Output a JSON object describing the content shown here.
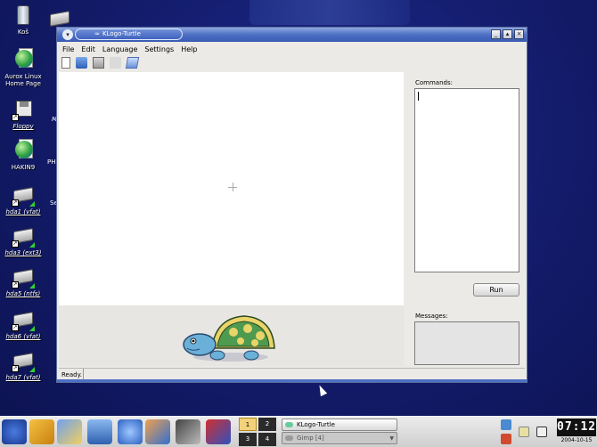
{
  "desktop": {
    "icons": [
      {
        "label": "Koš"
      },
      {
        "label": "Aurox Linux Home Page"
      },
      {
        "label": "Floppy"
      },
      {
        "label": "HAKIN9"
      },
      {
        "label": "hda1 (vfat)"
      },
      {
        "label": "hda3 (ext3)"
      },
      {
        "label": "hda5 (ntfs)"
      },
      {
        "label": "hda6 (vfat)"
      },
      {
        "label": "hda7 (vfat)"
      }
    ],
    "partial_labels": [
      "Mi",
      "PH",
      "Se"
    ]
  },
  "window": {
    "title": "KLogo-Turtle",
    "menu": [
      "File",
      "Edit",
      "Language",
      "Settings",
      "Help"
    ],
    "commands_label": "Commands:",
    "run_label": "Run",
    "messages_label": "Messages:",
    "status": "Ready."
  },
  "taskbar": {
    "pager": [
      "1",
      "2",
      "3",
      "4"
    ],
    "tasks": [
      {
        "label": "KLogo-Turtle",
        "active": true
      },
      {
        "label": "Gimp [4]",
        "active": false
      }
    ],
    "clock": {
      "time": "07:12",
      "date": "2004-10-15"
    }
  }
}
